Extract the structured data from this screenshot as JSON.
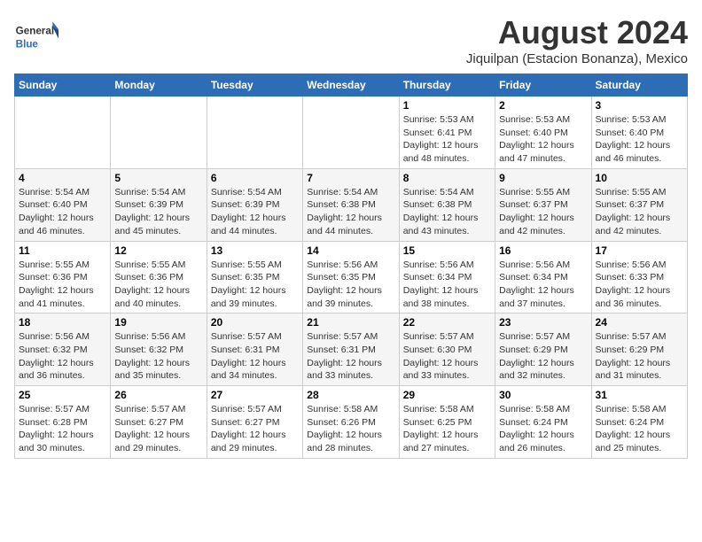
{
  "logo": {
    "line1": "General",
    "line2": "Blue"
  },
  "title": "August 2024",
  "subtitle": "Jiquilpan (Estacion Bonanza), Mexico",
  "days_of_week": [
    "Sunday",
    "Monday",
    "Tuesday",
    "Wednesday",
    "Thursday",
    "Friday",
    "Saturday"
  ],
  "weeks": [
    [
      {
        "day": "",
        "content": ""
      },
      {
        "day": "",
        "content": ""
      },
      {
        "day": "",
        "content": ""
      },
      {
        "day": "",
        "content": ""
      },
      {
        "day": "1",
        "content": "Sunrise: 5:53 AM\nSunset: 6:41 PM\nDaylight: 12 hours\nand 48 minutes."
      },
      {
        "day": "2",
        "content": "Sunrise: 5:53 AM\nSunset: 6:40 PM\nDaylight: 12 hours\nand 47 minutes."
      },
      {
        "day": "3",
        "content": "Sunrise: 5:53 AM\nSunset: 6:40 PM\nDaylight: 12 hours\nand 46 minutes."
      }
    ],
    [
      {
        "day": "4",
        "content": "Sunrise: 5:54 AM\nSunset: 6:40 PM\nDaylight: 12 hours\nand 46 minutes."
      },
      {
        "day": "5",
        "content": "Sunrise: 5:54 AM\nSunset: 6:39 PM\nDaylight: 12 hours\nand 45 minutes."
      },
      {
        "day": "6",
        "content": "Sunrise: 5:54 AM\nSunset: 6:39 PM\nDaylight: 12 hours\nand 44 minutes."
      },
      {
        "day": "7",
        "content": "Sunrise: 5:54 AM\nSunset: 6:38 PM\nDaylight: 12 hours\nand 44 minutes."
      },
      {
        "day": "8",
        "content": "Sunrise: 5:54 AM\nSunset: 6:38 PM\nDaylight: 12 hours\nand 43 minutes."
      },
      {
        "day": "9",
        "content": "Sunrise: 5:55 AM\nSunset: 6:37 PM\nDaylight: 12 hours\nand 42 minutes."
      },
      {
        "day": "10",
        "content": "Sunrise: 5:55 AM\nSunset: 6:37 PM\nDaylight: 12 hours\nand 42 minutes."
      }
    ],
    [
      {
        "day": "11",
        "content": "Sunrise: 5:55 AM\nSunset: 6:36 PM\nDaylight: 12 hours\nand 41 minutes."
      },
      {
        "day": "12",
        "content": "Sunrise: 5:55 AM\nSunset: 6:36 PM\nDaylight: 12 hours\nand 40 minutes."
      },
      {
        "day": "13",
        "content": "Sunrise: 5:55 AM\nSunset: 6:35 PM\nDaylight: 12 hours\nand 39 minutes."
      },
      {
        "day": "14",
        "content": "Sunrise: 5:56 AM\nSunset: 6:35 PM\nDaylight: 12 hours\nand 39 minutes."
      },
      {
        "day": "15",
        "content": "Sunrise: 5:56 AM\nSunset: 6:34 PM\nDaylight: 12 hours\nand 38 minutes."
      },
      {
        "day": "16",
        "content": "Sunrise: 5:56 AM\nSunset: 6:34 PM\nDaylight: 12 hours\nand 37 minutes."
      },
      {
        "day": "17",
        "content": "Sunrise: 5:56 AM\nSunset: 6:33 PM\nDaylight: 12 hours\nand 36 minutes."
      }
    ],
    [
      {
        "day": "18",
        "content": "Sunrise: 5:56 AM\nSunset: 6:32 PM\nDaylight: 12 hours\nand 36 minutes."
      },
      {
        "day": "19",
        "content": "Sunrise: 5:56 AM\nSunset: 6:32 PM\nDaylight: 12 hours\nand 35 minutes."
      },
      {
        "day": "20",
        "content": "Sunrise: 5:57 AM\nSunset: 6:31 PM\nDaylight: 12 hours\nand 34 minutes."
      },
      {
        "day": "21",
        "content": "Sunrise: 5:57 AM\nSunset: 6:31 PM\nDaylight: 12 hours\nand 33 minutes."
      },
      {
        "day": "22",
        "content": "Sunrise: 5:57 AM\nSunset: 6:30 PM\nDaylight: 12 hours\nand 33 minutes."
      },
      {
        "day": "23",
        "content": "Sunrise: 5:57 AM\nSunset: 6:29 PM\nDaylight: 12 hours\nand 32 minutes."
      },
      {
        "day": "24",
        "content": "Sunrise: 5:57 AM\nSunset: 6:29 PM\nDaylight: 12 hours\nand 31 minutes."
      }
    ],
    [
      {
        "day": "25",
        "content": "Sunrise: 5:57 AM\nSunset: 6:28 PM\nDaylight: 12 hours\nand 30 minutes."
      },
      {
        "day": "26",
        "content": "Sunrise: 5:57 AM\nSunset: 6:27 PM\nDaylight: 12 hours\nand 29 minutes."
      },
      {
        "day": "27",
        "content": "Sunrise: 5:57 AM\nSunset: 6:27 PM\nDaylight: 12 hours\nand 29 minutes."
      },
      {
        "day": "28",
        "content": "Sunrise: 5:58 AM\nSunset: 6:26 PM\nDaylight: 12 hours\nand 28 minutes."
      },
      {
        "day": "29",
        "content": "Sunrise: 5:58 AM\nSunset: 6:25 PM\nDaylight: 12 hours\nand 27 minutes."
      },
      {
        "day": "30",
        "content": "Sunrise: 5:58 AM\nSunset: 6:24 PM\nDaylight: 12 hours\nand 26 minutes."
      },
      {
        "day": "31",
        "content": "Sunrise: 5:58 AM\nSunset: 6:24 PM\nDaylight: 12 hours\nand 25 minutes."
      }
    ]
  ],
  "colors": {
    "header_bg": "#2d6db5",
    "header_text": "#ffffff"
  }
}
